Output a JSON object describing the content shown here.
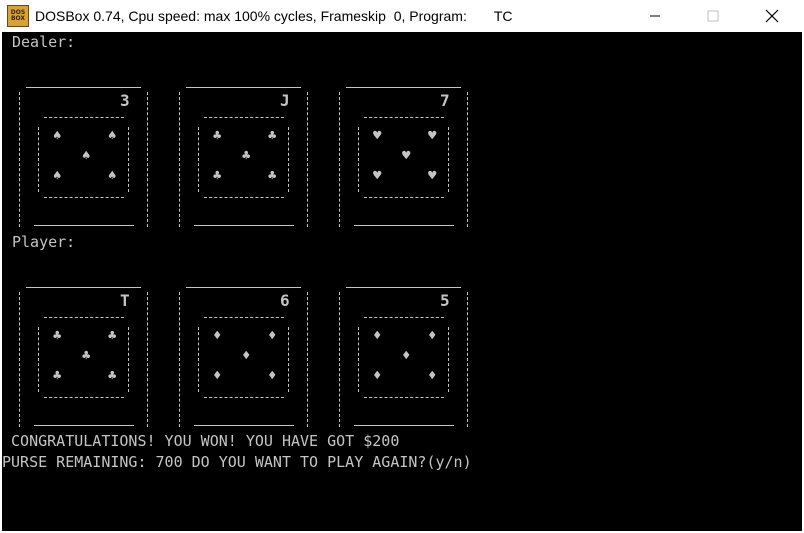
{
  "window": {
    "title": "DOSBox 0.74, Cpu speed: max 100% cycles, Frameskip  0, Program:       TC",
    "icon_label_top": "DOS",
    "icon_label_bottom": "BOX",
    "controls": [
      "minimize-icon",
      "maximize-icon",
      "close-icon"
    ]
  },
  "colors": {
    "screen_bg": "#000000",
    "text": "#c4c4c4",
    "icon": "#d8a23a"
  },
  "console": {
    "dealer_label": "Dealer:",
    "player_label": "Player:",
    "message_line1": " CONGRATULATIONS! YOU WON! YOU HAVE GOT $200",
    "message_line2": "PURSE REMAINING: 700 DO YOU WANT TO PLAY AGAIN?(y/n)"
  },
  "dealer_cards": [
    {
      "rank": "3",
      "suit": "spade",
      "pip": "♠"
    },
    {
      "rank": "J",
      "suit": "club",
      "pip": "♣"
    },
    {
      "rank": "7",
      "suit": "heart",
      "pip": "♥"
    }
  ],
  "player_cards": [
    {
      "rank": "T",
      "suit": "club",
      "pip": "♣"
    },
    {
      "rank": "6",
      "suit": "diamond",
      "pip": "♦"
    },
    {
      "rank": "5",
      "suit": "diamond",
      "pip": "♦"
    }
  ]
}
